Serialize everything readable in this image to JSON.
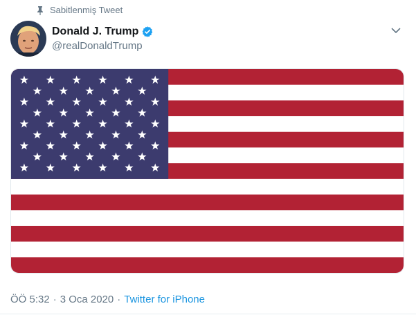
{
  "pinned": {
    "label": "Sabitlenmiş Tweet",
    "icon": "pin-icon"
  },
  "author": {
    "display_name": "Donald J. Trump",
    "handle": "@realDonaldTrump",
    "verified": true,
    "avatar_icon": "avatar"
  },
  "tweet": {
    "media_description_icon": "us-flag-image",
    "time": "ÖÖ 5:32",
    "separator": "·",
    "date": "3 Oca 2020",
    "separator2": "·",
    "source": "Twitter for iPhone"
  },
  "colors": {
    "flag_red": "#b22234",
    "flag_blue": "#3c3b6e",
    "verified_blue": "#1da1f2",
    "link_blue": "#1b95e0",
    "secondary_text": "#657786"
  }
}
